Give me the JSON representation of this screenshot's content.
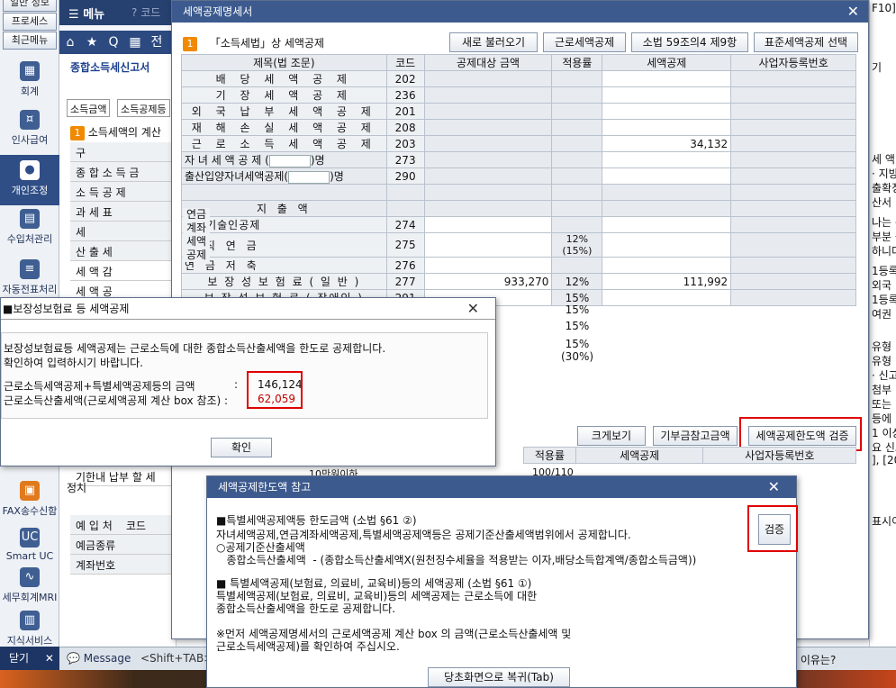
{
  "sidebar": {
    "top_buttons": [
      "일반 정보",
      "프로세스",
      "최근메뉴"
    ],
    "items": [
      {
        "label": "회계",
        "icon": "calculator-icon"
      },
      {
        "label": "인사급여",
        "icon": "person-coin-icon"
      },
      {
        "label": "개인조정",
        "icon": "person-icon"
      },
      {
        "label": "수입처관리",
        "icon": "building-icon"
      },
      {
        "label": "자동전표처리",
        "icon": "database-icon"
      },
      {
        "label": "FAX송수신함",
        "icon": "fax-icon"
      },
      {
        "label": "Smart UC",
        "icon": "uc-icon"
      },
      {
        "label": "세무회계MRI",
        "icon": "chart-pulse-icon"
      },
      {
        "label": "지식서비스",
        "icon": "book-icon"
      }
    ],
    "close_label": "닫기",
    "close_x": "✕"
  },
  "menubar": {
    "menu_label": "메뉴",
    "code_label": "코드"
  },
  "iconbar": {
    "glyphs": [
      "⌂",
      "★",
      "Q",
      "▦",
      "전"
    ]
  },
  "bgform": {
    "title": "종합소득세신고서",
    "tabs": [
      "소득금액",
      "소득공제등"
    ],
    "section_badge": "1",
    "section_label": "소득세액의 계산",
    "rows": [
      "구",
      "종 합 소 득 금",
      "소 득 공 제",
      "과 세 표",
      "세",
      "산 출 세",
      "세 액 감",
      "세 액 공",
      "기한내 납부 할 세",
      "정치",
      "예 입 처",
      "예금종류",
      "계좌번호"
    ],
    "col_code": "코드",
    "col_bu": "분"
  },
  "right_bg": [
    "F10]",
    "기",
    "세 액 -",
    "· 지방",
    "출확정",
    "산서",
    "나는 규",
    "부분 등",
    "하니다",
    "1등록",
    "외국",
    "1등록",
    "여권",
    "유형",
    "유형",
    "· 신고",
    "첨부",
    "또는",
    "등에",
    "1 이상",
    "요 신고",
    "], [20",
    "표시이",
    "른 이유는?"
  ],
  "statusbar": {
    "message": "Message",
    "shift": "<Shift+TAB>",
    "reason": "른 이유는?"
  },
  "main": {
    "title": "세액공제명세서",
    "close": "✕",
    "section_badge": "1",
    "section_label": "「소득세법」상 세액공제",
    "buttons": [
      "새로 불러오기",
      "근로세액공제",
      "소법 59조의4 제9항",
      "표준세액공제 선택"
    ],
    "headers": [
      "제목(법 조문)",
      "코드",
      "공제대상 금액",
      "적용률",
      "세액공제",
      "사업자등록번호"
    ],
    "rows": [
      {
        "label": "배 당 세 액 공 제",
        "code": "202",
        "amount": "",
        "rate": "",
        "credit": ""
      },
      {
        "label": "기 장 세 액 공 제",
        "code": "236",
        "amount": "",
        "rate": "",
        "credit": ""
      },
      {
        "label": "외 국 납 부 세 액 공 제",
        "code": "201",
        "amount": "",
        "rate": "",
        "credit": ""
      },
      {
        "label": "재 해 손 실 세 액 공 제",
        "code": "208",
        "amount": "",
        "rate": "",
        "credit": ""
      },
      {
        "label": "근 로 소 득 세 액 공 제",
        "code": "203",
        "amount": "",
        "rate": "",
        "credit": "34,132"
      }
    ],
    "child_row": {
      "label": "자 녀 세 액 공 제 (",
      "unit": ")명",
      "code": "273"
    },
    "birth_row": {
      "label": "출산입양자녀세액공제(",
      "unit": ")명",
      "code": "290"
    },
    "pension_group": "연금계좌세액공제",
    "pension_header": "지 출 액",
    "pension_rows": [
      {
        "label": "과학기술인공제",
        "code": "274"
      },
      {
        "label": "퇴 직 연 금",
        "code": "275"
      },
      {
        "label": "연 금 저 축",
        "code": "276"
      }
    ],
    "pension_rate": "12%",
    "pension_rate2": "(15%)",
    "insurance_rows": [
      {
        "label": "보 장 성 보 험 료 ( 일 반 )",
        "code": "277",
        "amount": "933,270",
        "rate": "12%",
        "credit": "111,992"
      },
      {
        "label": "보 장 성 보 험 료 ( 장애인 )",
        "code": "291",
        "amount": "",
        "rate": "15%",
        "credit": ""
      }
    ],
    "extra_rates": [
      "15%",
      "15%",
      "15%",
      "(30%)"
    ],
    "lower_buttons": [
      "크게보기",
      "기부금참고금액",
      "세액공제한도액 검증"
    ],
    "lower_headers": [
      "적용률",
      "세액공제",
      "사업자등록번호"
    ],
    "lower_row": {
      "label": "10만원이하",
      "rate": "100/110"
    }
  },
  "popup1": {
    "title": "■보장성보험료 등 세액공제",
    "close": "✕",
    "line1": "보장성보험료등 세액공제는 근로소득에 대한 종합소득산출세액을 한도로 공제합니다.",
    "line2": "확인하여 입력하시기 바랍니다.",
    "label_a": "근로소득세액공제+특별세액공제등의 금액",
    "colon_a": ":",
    "value_a": "146,124",
    "label_b": "근로소득산출세액(근로세액공제 계산 box 참조) :",
    "value_b": "62,059",
    "confirm": "확인"
  },
  "popup2": {
    "title": "세액공제한도액 참고",
    "close": "✕",
    "verify": "검증",
    "lines": [
      "■특별세액공제액등 한도금액 (소법 §61 ②)",
      "자녀세액공제,연금계좌세액공제,특별세액공제액등은 공제기준산출세액범위에서 공제합니다.",
      "○공제기준산출세액",
      "   종합소득산출세액  - (종합소득산출세액X(원천징수세율을 적용받는 이자,배당소득합계액/종합소득금액))",
      "",
      "■ 특별세액공제(보험료, 의료비, 교육비)등의 세액공제 (소법 §61 ①)",
      "특별세액공제(보험료, 의료비, 교육비)등의 세액공제는 근로소득에 대한",
      "종합소득산출세액을 한도로 공제합니다.",
      "",
      "※먼저 세액공제명세서의 근로세액공제 계산 box 의 금액(근로소득산출세액 및",
      "근로소득세액공제)를 확인하여 주십시오."
    ],
    "restore": "당초화면으로 복귀(Tab)"
  },
  "colors": {
    "title_bar": "#3c5a8e",
    "highlight_border": "#e00000",
    "value_red": "#c00000",
    "badge": "#f08a00"
  }
}
